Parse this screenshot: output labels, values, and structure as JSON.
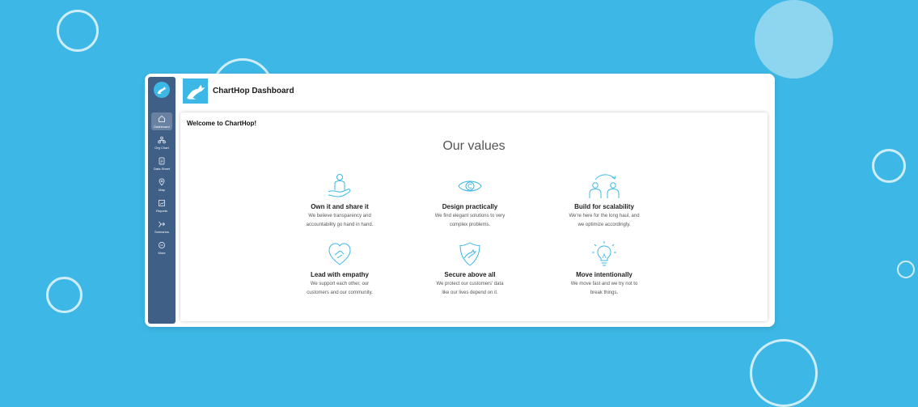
{
  "app": {
    "title": "ChartHop Dashboard"
  },
  "sidebar": {
    "items": [
      {
        "label": "Dashboard",
        "icon": "home-icon",
        "active": true
      },
      {
        "label": "Org Chart",
        "icon": "org-chart-icon",
        "active": false
      },
      {
        "label": "Data Sheet",
        "icon": "document-icon",
        "active": false
      },
      {
        "label": "Map",
        "icon": "map-pin-icon",
        "active": false
      },
      {
        "label": "Reports",
        "icon": "chart-icon",
        "active": false
      },
      {
        "label": "Scenarios",
        "icon": "scenario-icon",
        "active": false
      },
      {
        "label": "More",
        "icon": "more-icon",
        "active": false
      }
    ]
  },
  "main": {
    "welcome": "Welcome to ChartHop!",
    "heading": "Our values",
    "values": [
      {
        "title": "Own it and share it",
        "desc1": "We believe transparency and",
        "desc2": "accountability go hand in hand.",
        "icon": "hand-person-icon"
      },
      {
        "title": "Design practically",
        "desc1": "We find elegant solutions to very",
        "desc2": "complex problems.",
        "icon": "eye-icon"
      },
      {
        "title": "Build for scalability",
        "desc1": "We're here for the long haul, and",
        "desc2": "we optimize accordingly.",
        "icon": "people-cycle-icon"
      },
      {
        "title": "Lead with empathy",
        "desc1": "We support each other, our",
        "desc2": "customers and our community.",
        "icon": "heart-hand-icon"
      },
      {
        "title": "Secure above all",
        "desc1": "We protect our customers' data",
        "desc2": "like our lives depend on it.",
        "icon": "shield-icon"
      },
      {
        "title": "Move intentionally",
        "desc1": "We move fast and we try not to",
        "desc2": "break things.",
        "icon": "lightbulb-icon"
      }
    ]
  },
  "colors": {
    "background": "#3db8e6",
    "sidebar": "#3f5f87",
    "accent": "#3db8e6"
  }
}
